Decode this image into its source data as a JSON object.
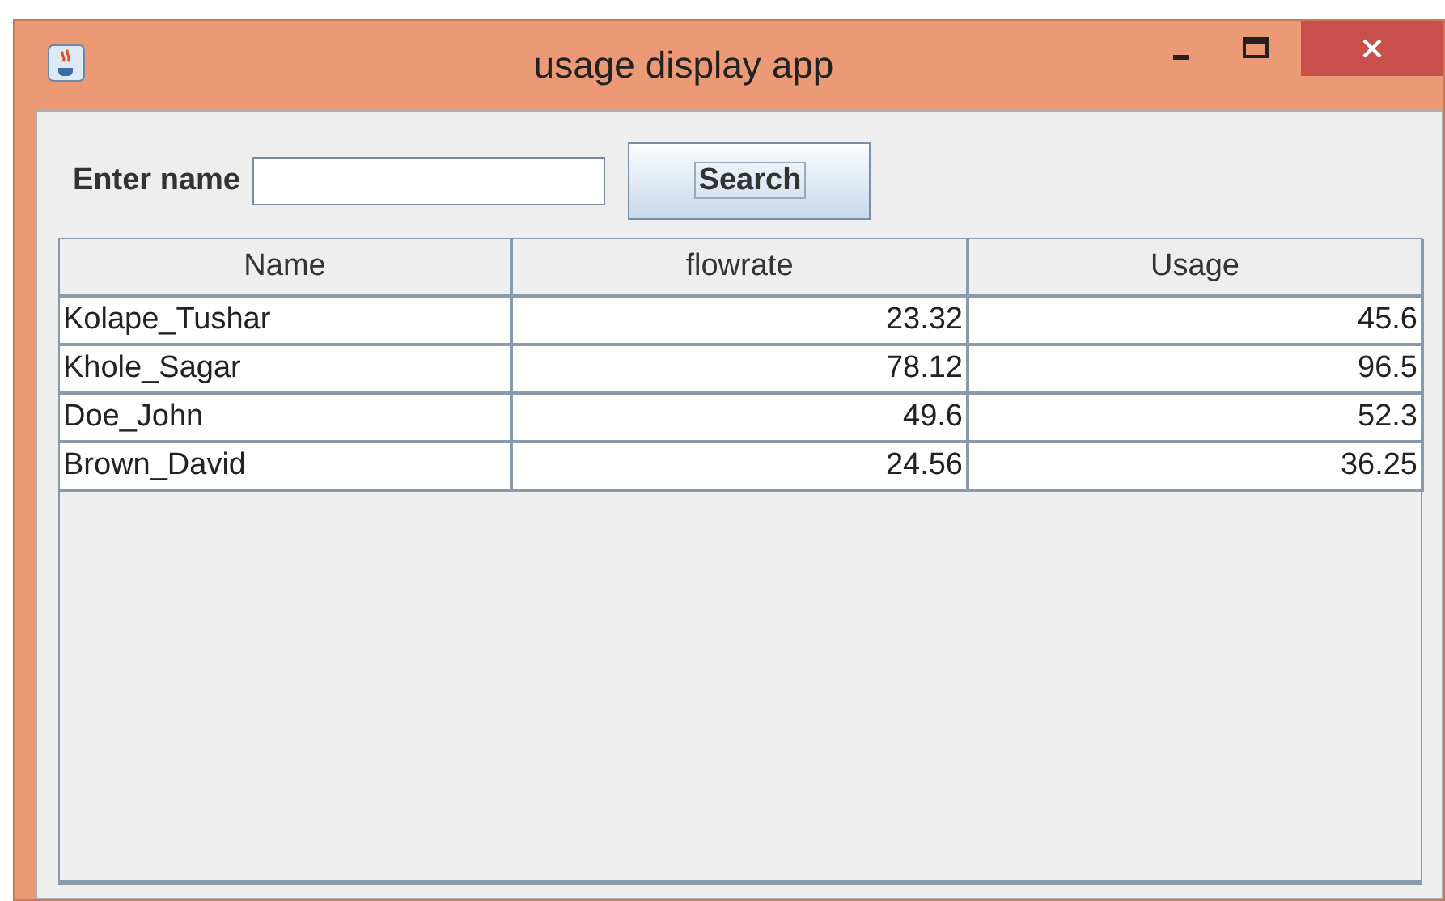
{
  "window": {
    "title": "usage display app"
  },
  "search": {
    "label": "Enter name",
    "button": "Search"
  },
  "table": {
    "columns": [
      "Name",
      "flowrate",
      "Usage"
    ],
    "rows": [
      {
        "cells": [
          "Kolape_Tushar",
          "23.32",
          "45.6"
        ]
      },
      {
        "cells": [
          "Khole_Sagar",
          "78.12",
          "96.5"
        ]
      },
      {
        "cells": [
          "Doe_John",
          "49.6",
          "52.3"
        ]
      },
      {
        "cells": [
          "Brown_David",
          "24.56",
          "36.25"
        ]
      }
    ]
  }
}
